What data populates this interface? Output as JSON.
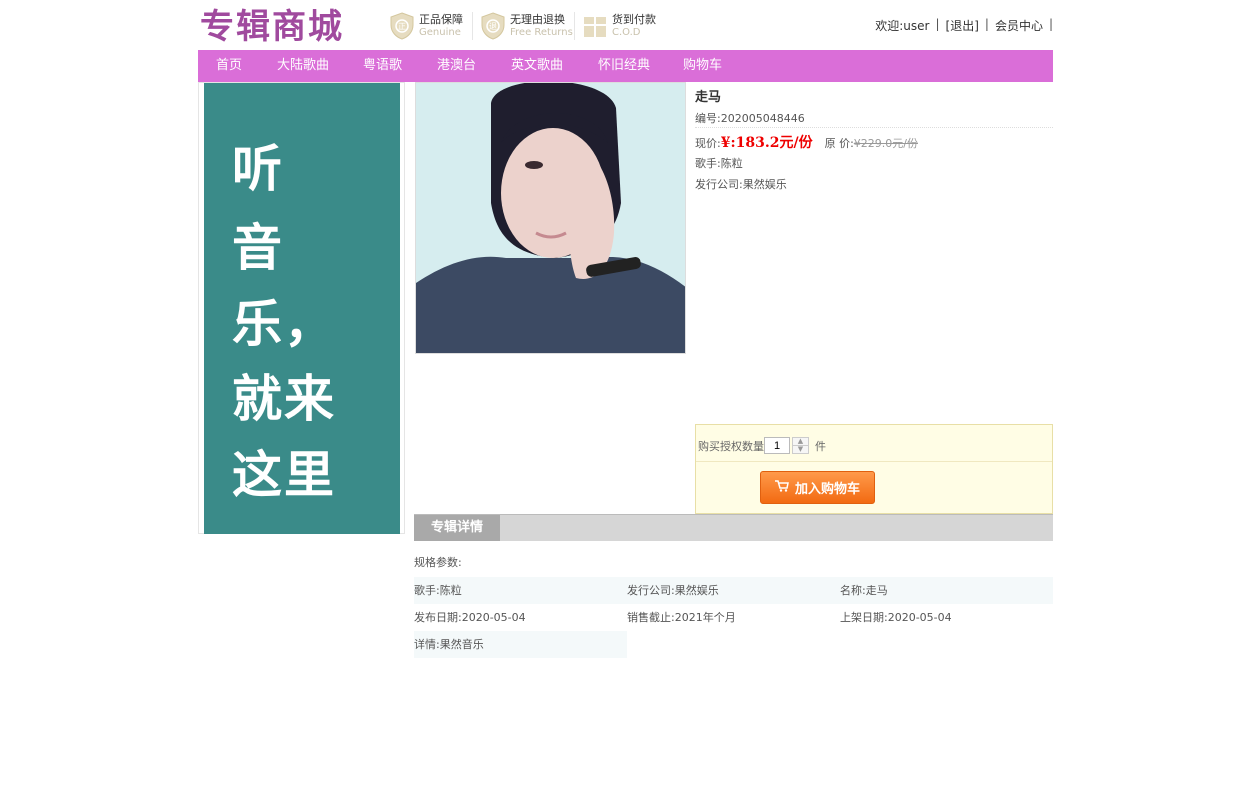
{
  "header": {
    "logo": "专辑商城",
    "assurances": [
      {
        "title": "正品保障",
        "subtitle": "Genuine",
        "icon": "shield-genuine-icon"
      },
      {
        "title": "无理由退换",
        "subtitle": "Free Returns",
        "icon": "shield-return-icon"
      },
      {
        "title": "货到付款",
        "subtitle": "C.O.D",
        "icon": "gift-box-icon"
      }
    ],
    "welcome": "欢迎:user",
    "logout": "[退出]",
    "member_center": "会员中心",
    "separator": "|"
  },
  "nav": {
    "items": [
      "首页",
      "大陆歌曲",
      "粤语歌",
      "港澳台",
      "英文歌曲",
      "怀旧经典",
      "购物车"
    ]
  },
  "banner": {
    "lines": [
      "听",
      "音",
      "乐，",
      "就来",
      "这里"
    ],
    "bg_color": "#3a8b89"
  },
  "product": {
    "title": "走马",
    "code": "编号:202005048446",
    "price_label": "现价:",
    "price": "¥:183.2元/份",
    "original_label": "原 价:",
    "original_price": "¥229.0元/份",
    "singer": "歌手:陈粒",
    "company": "发行公司:果然娱乐",
    "price_color": "#e00000"
  },
  "buy": {
    "qty_label": "购买授权数量",
    "qty_value": "1",
    "unit": "件",
    "add_to_cart": "加入购物车"
  },
  "details": {
    "tab": "专辑详情",
    "spec_label": "规格参数:",
    "rows": [
      [
        "歌手:陈粒",
        "发行公司:果然娱乐",
        "名称:走马"
      ],
      [
        "发布日期:2020-05-04",
        "销售截止:2021年个月",
        "上架日期:2020-05-04"
      ],
      [
        "详情:果然音乐"
      ]
    ]
  },
  "colors": {
    "nav_bg": "#da6ed8",
    "logo": "#a04a9e",
    "cart_button": "#f26a12"
  }
}
